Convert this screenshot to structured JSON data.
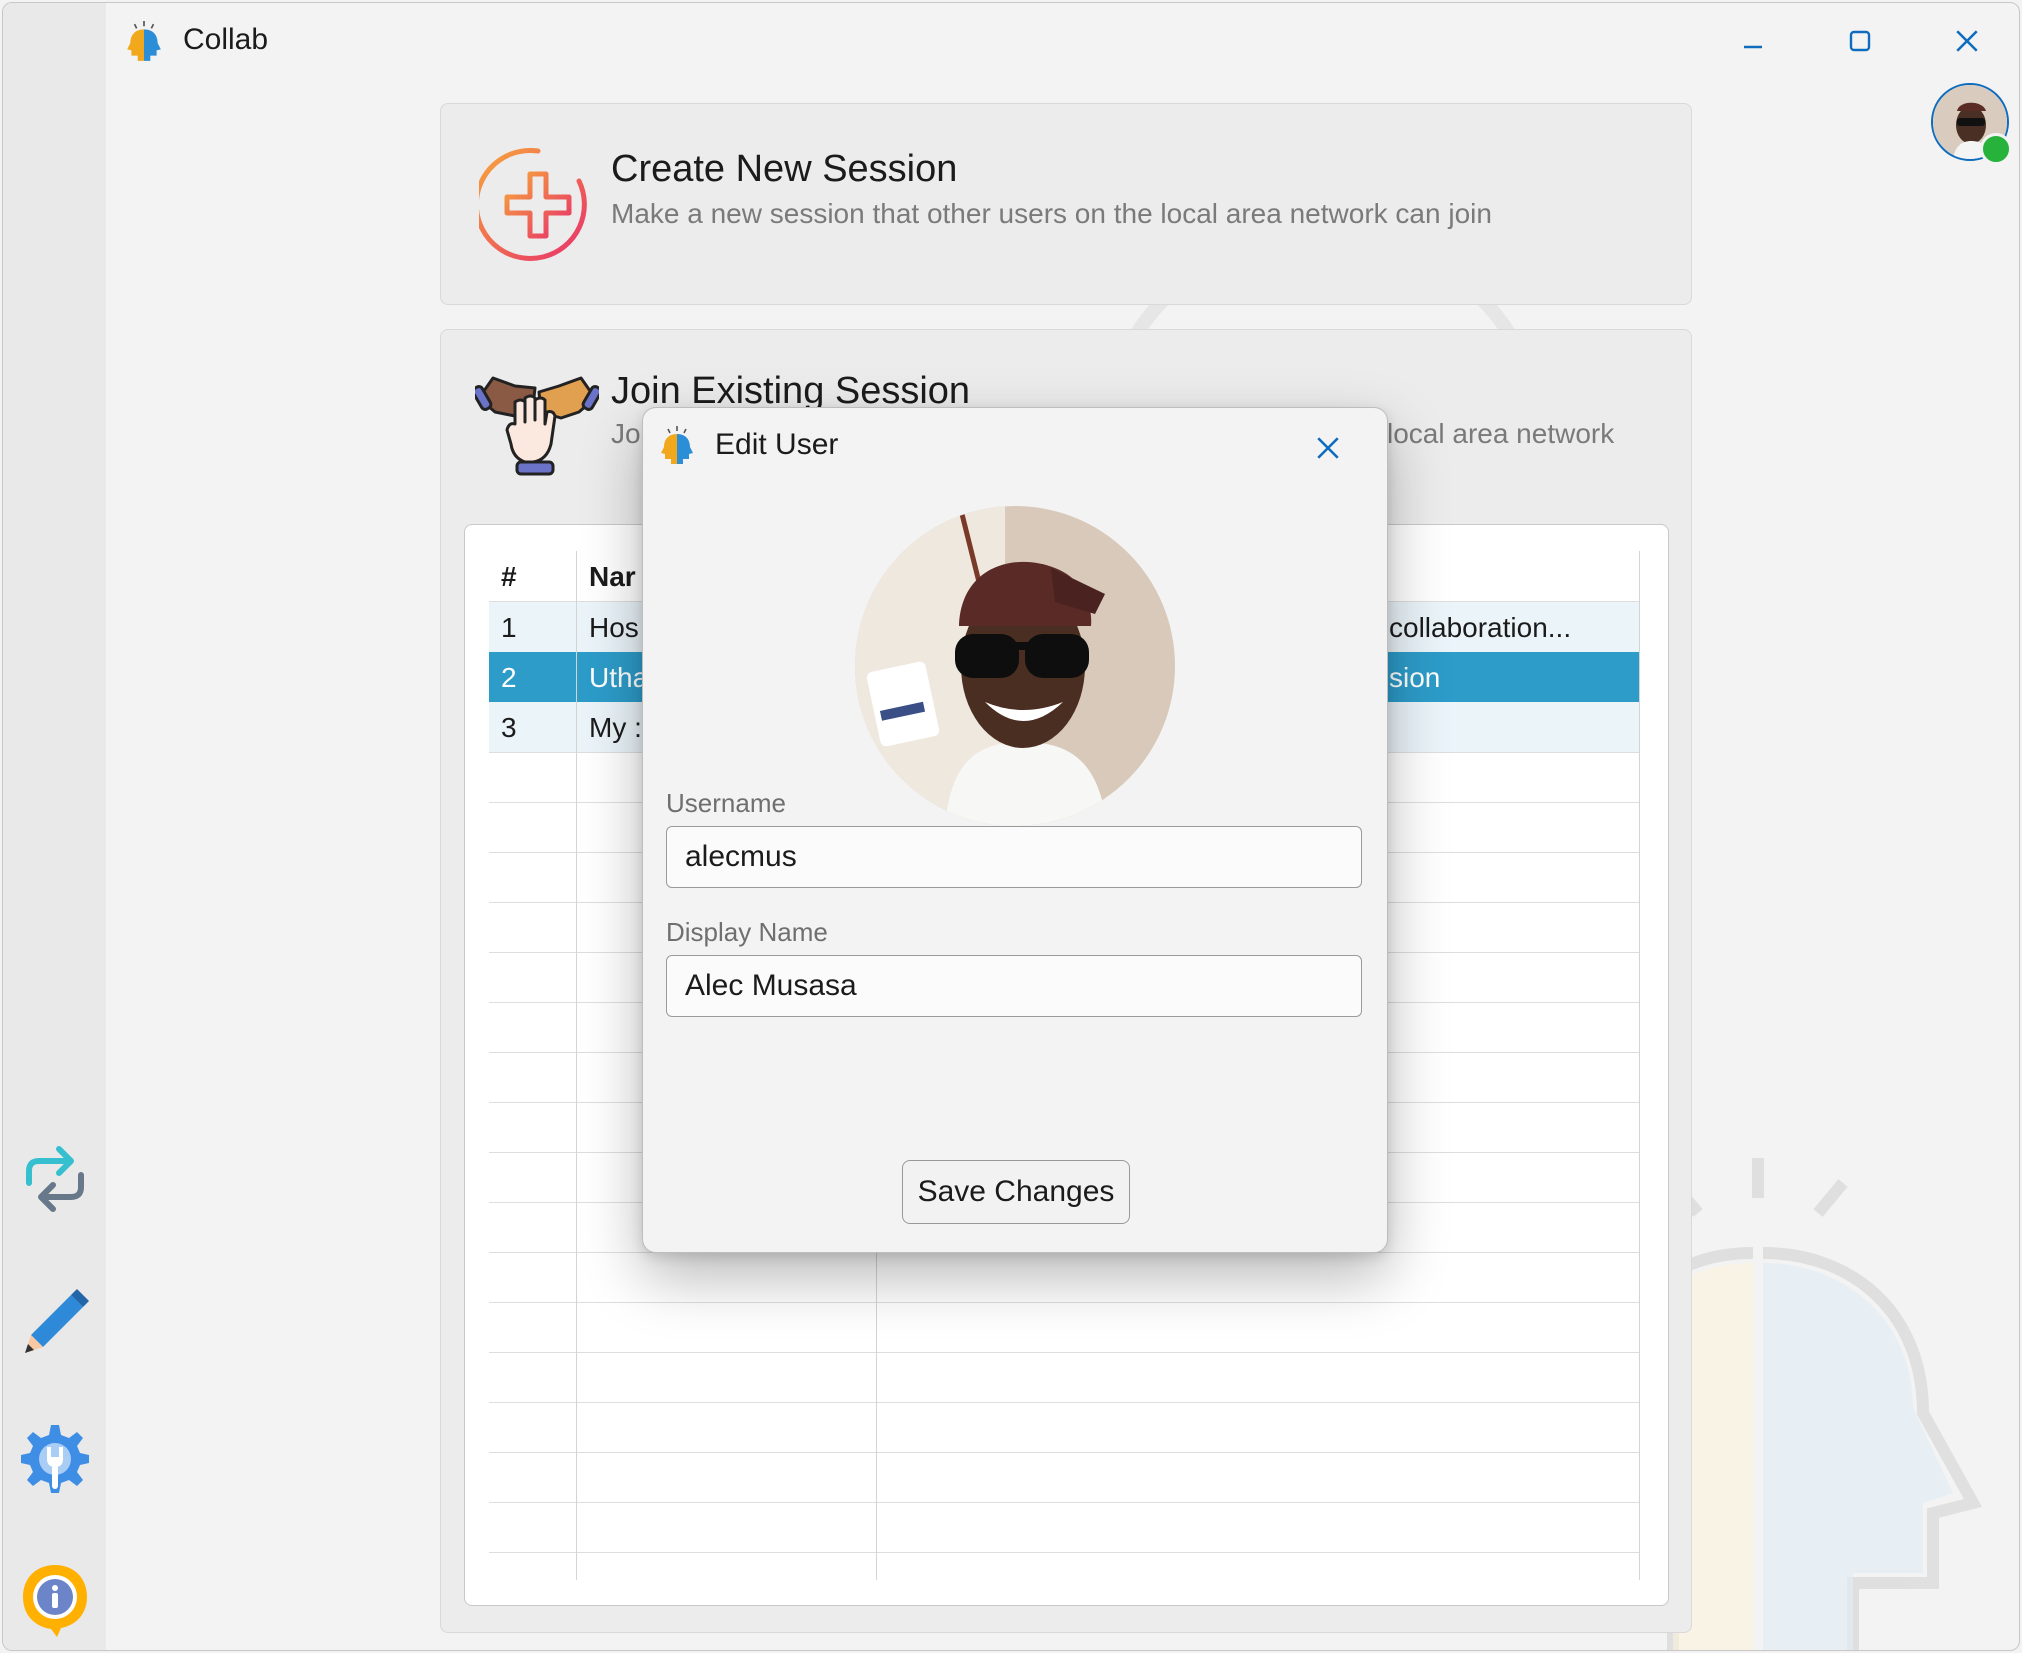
{
  "app": {
    "title": "Collab"
  },
  "cards": {
    "create": {
      "title": "Create New Session",
      "description": "Make a new session that other users on the local area network can join"
    },
    "join": {
      "title": "Join Existing Session",
      "description_visible_start": "Joi",
      "description_visible_end": "local area network"
    }
  },
  "table": {
    "headers": {
      "num": "#",
      "name": "Nar"
    },
    "rows": [
      {
        "num": "1",
        "name": "Hos",
        "desc": "collaboration..."
      },
      {
        "num": "2",
        "name": "Utha",
        "desc": "sion"
      },
      {
        "num": "3",
        "name": "My :",
        "desc": ""
      }
    ]
  },
  "dialog": {
    "title": "Edit User",
    "username_label": "Username",
    "username_value": "alecmus",
    "display_name_label": "Display Name",
    "display_name_value": "Alec Musasa",
    "save_label": "Save Changes"
  },
  "colors": {
    "selected_row": "#2d9cc9",
    "accent": "#0f6cbd",
    "online": "#27b33b"
  },
  "icons": {
    "title_logo": "collab-logo-icon",
    "minimize": "minimize-icon",
    "maximize": "maximize-icon",
    "close": "close-icon",
    "create": "plus-circle-icon",
    "join": "handshake-icon",
    "sidebar": [
      "sync-icon",
      "pencil-icon",
      "settings-gear-icon",
      "info-icon"
    ]
  }
}
